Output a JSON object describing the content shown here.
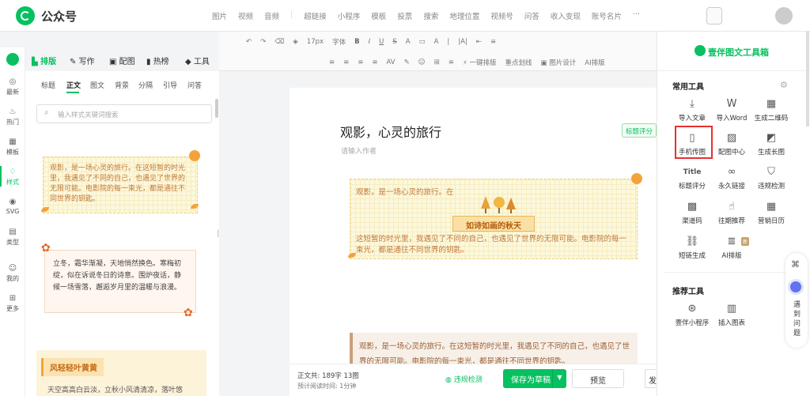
{
  "app": {
    "brand": "公众号"
  },
  "top_menu": [
    "图片",
    "视频",
    "音频",
    "|",
    "超链接",
    "小程序",
    "模板",
    "投票",
    "搜索",
    "地理位置",
    "视频号",
    "问答",
    "收入变现",
    "账号名片",
    "···"
  ],
  "left_rail": [
    {
      "label": "最新",
      "icon": "new-icon"
    },
    {
      "label": "热门",
      "icon": "fire-icon"
    },
    {
      "label": "模板",
      "icon": "template-icon"
    },
    {
      "label": "样式",
      "icon": "style-icon",
      "active": true
    },
    {
      "label": "SVG",
      "icon": "svg-icon"
    },
    {
      "label": "类型",
      "icon": "type-icon"
    },
    {
      "label": "我的",
      "icon": "user-icon"
    },
    {
      "label": "更多",
      "icon": "more-icon"
    }
  ],
  "panel_tabs": [
    "排版",
    "写作",
    "配图",
    "热榜",
    "工具"
  ],
  "sub_tabs": [
    "标题",
    "正文",
    "图文",
    "背景",
    "分隔",
    "引导",
    "问答"
  ],
  "search": {
    "placeholder": "输入样式关键词搜索"
  },
  "cards": {
    "card1": "观影，是一场心灵的旅行。在这短暂的时光里，我遇见了不同的自己，也遇见了世界的无限可能。电影院的每一束光，都是通往不同世界的钥匙。",
    "card2": "立冬，霜华渐凝，天地悄然换色。寒梅初绽，似在诉说冬日的诗意。围炉夜话，静候一场雪落，邂逅岁月里的温暖与浪漫。",
    "card3_title": "风轻轻叶黄黄",
    "card3_text": "天空高高白云淡，立秋小风清清凉，落叶悠"
  },
  "toolbar": {
    "row1": [
      "↶",
      "↷",
      "⌫",
      "◈",
      "17px",
      "字体",
      "B",
      "I",
      "U",
      "S",
      "A",
      "▭",
      "A",
      "|",
      "|A|",
      "⇤",
      "≡"
    ],
    "row2": [
      "≡",
      "≡",
      "≡",
      "≡",
      "AV",
      "✎",
      "☺",
      "⊞",
      "≡",
      "⚡ 一键排版",
      "重点划线",
      "▣ 图片设计",
      "AI排版"
    ]
  },
  "article": {
    "title": "观影，心灵的旅行",
    "author_placeholder": "请输入作者",
    "title_eval": "标题评分",
    "block1_line1": "观影，是一场心灵的旅行。在",
    "banner": "如诗如画的秋天",
    "block1_line2": "这短暂的时光里，我遇见了不同的自己，也遇见了世界的无限可能。电影院的每一束光，都是通往不同世界的钥匙。",
    "block2": "观影，是一场心灵的旅行。在这短暂的时光里，我遇见了不同的自己，也遇见了世界的无限可能。电影院的每一束光，都是通往不同世界的钥匙。"
  },
  "footer": {
    "stats": "正文共: 189字 13图",
    "read_time": "预计阅读时间: 1分钟",
    "check": "违规检测",
    "save": "保存为草稿",
    "preview": "预览",
    "publish": "发"
  },
  "right_panel": {
    "title": "壹伴图文工具箱",
    "common_title": "常用工具",
    "recommend_title": "推荐工具",
    "new_badge": "新",
    "tools": [
      {
        "label": "导入文章",
        "icon": "import-icon"
      },
      {
        "label": "导入Word",
        "icon": "word-icon"
      },
      {
        "label": "生成二维码",
        "icon": "qrcode-icon"
      },
      {
        "label": "手机传图",
        "icon": "phone-upload-icon"
      },
      {
        "label": "配图中心",
        "icon": "image-icon"
      },
      {
        "label": "生成长图",
        "icon": "longimage-icon"
      },
      {
        "label": "标题评分",
        "icon": "title-icon"
      },
      {
        "label": "永久链接",
        "icon": "link-icon"
      },
      {
        "label": "违规检测",
        "icon": "shield-icon"
      },
      {
        "label": "渠道码",
        "icon": "channel-qr-icon"
      },
      {
        "label": "往期推荐",
        "icon": "thumb-icon"
      },
      {
        "label": "营销日历",
        "icon": "calendar-icon"
      },
      {
        "label": "短链生成",
        "icon": "shortlink-icon"
      },
      {
        "label": "AI排版",
        "icon": "ai-icon"
      }
    ],
    "recommend": [
      {
        "label": "壹伴小程序",
        "icon": "miniapp-icon"
      },
      {
        "label": "插入图表",
        "icon": "chart-icon"
      }
    ]
  },
  "float": {
    "text": "遇到问题"
  }
}
